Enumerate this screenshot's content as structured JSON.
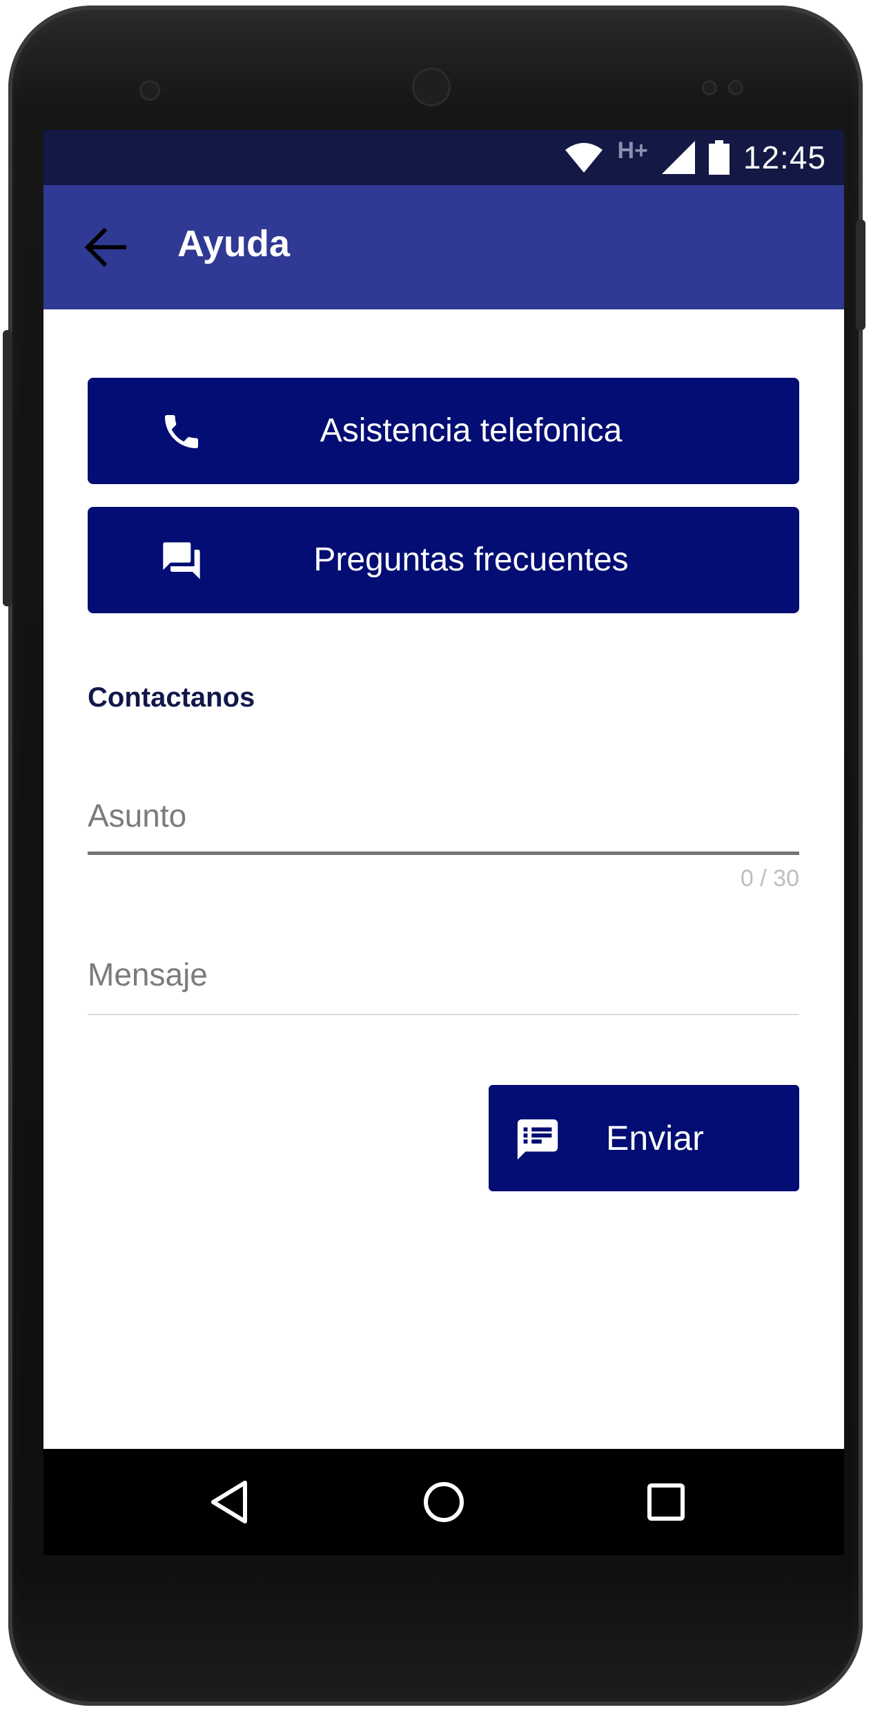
{
  "status_bar": {
    "network_type": "H+",
    "time": "12:45",
    "icons": [
      "wifi-icon",
      "network-type-icon",
      "signal-icon",
      "battery-icon"
    ]
  },
  "app_bar": {
    "title": "Ayuda",
    "back_icon": "arrow-left-icon"
  },
  "actions": [
    {
      "label": "Asistencia telefonica",
      "icon": "phone-icon"
    },
    {
      "label": "Preguntas frecuentes",
      "icon": "forum-icon"
    }
  ],
  "contact": {
    "section_title": "Contactanos",
    "subject_placeholder": "Asunto",
    "subject_value": "",
    "subject_counter": "0 / 30",
    "message_placeholder": "Mensaje",
    "message_value": "",
    "send_label": "Enviar",
    "send_icon": "message-icon"
  },
  "nav_bar": {
    "buttons": [
      "back-triangle-icon",
      "home-circle-icon",
      "recents-square-icon"
    ]
  },
  "colors": {
    "status_bar": "#141845",
    "app_bar": "#303993",
    "primary_button": "#030d73",
    "section_title": "#12174b"
  }
}
